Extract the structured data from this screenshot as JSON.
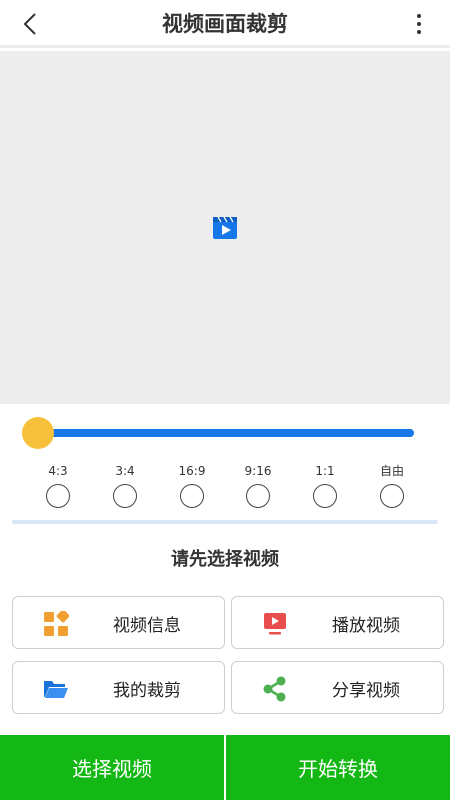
{
  "header": {
    "title": "视频画面裁剪"
  },
  "crop": {
    "slider_level": 0,
    "ratios": [
      "4:3",
      "3:4",
      "16:9",
      "9:16",
      "1:1",
      "自由"
    ]
  },
  "status": {
    "message": "请先选择视频"
  },
  "actions": {
    "video_info": "视频信息",
    "play_video": "播放视频",
    "my_crops": "我的裁剪",
    "share_video": "分享视频"
  },
  "bottom": {
    "select_video": "选择视频",
    "start_convert": "开始转换"
  },
  "colors": {
    "accent_blue": "#1677e8",
    "thumb_yellow": "#f7c03a",
    "button_green": "#14b814",
    "info_orange": "#f0a030",
    "play_red": "#e94e4e",
    "folder_blue": "#1a73d9",
    "share_green": "#4caf50"
  },
  "icons": [
    "back-arrow-icon",
    "more-vert-icon",
    "video-play-icon",
    "grid-apps-icon",
    "tv-play-icon",
    "folder-open-icon",
    "share-icon"
  ]
}
